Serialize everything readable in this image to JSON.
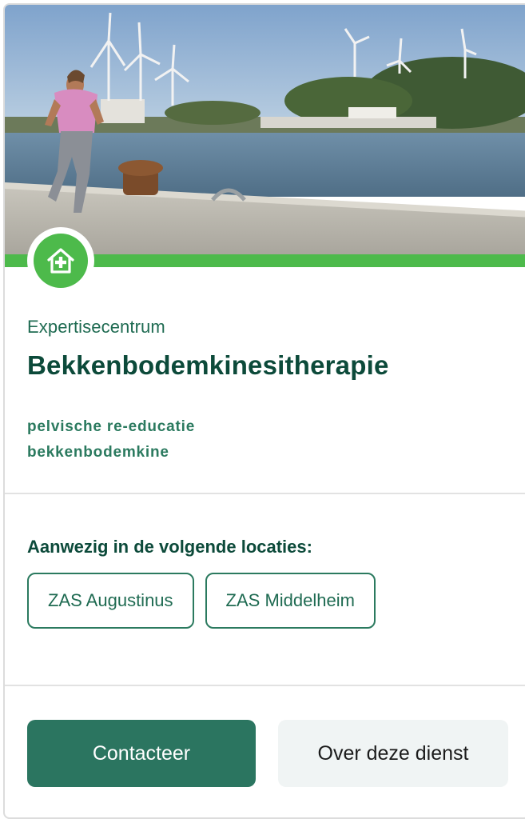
{
  "card": {
    "icon": "hospital-house-icon",
    "kicker": "Expertisecentrum",
    "title": "Bekkenbodemkinesitherapie",
    "tags": [
      "pelvische re-educatie",
      "bekkenbodemkine"
    ],
    "locations_heading": "Aanwezig in de volgende locaties:",
    "locations": [
      "ZAS Augustinus",
      "ZAS Middelheim"
    ],
    "primary_button": "Contacteer",
    "secondary_button": "Over deze dienst"
  },
  "colors": {
    "accent_green": "#4dba4b",
    "dark_green": "#0c4a3a",
    "button_green": "#2b7560",
    "secondary_bg": "#f0f4f4"
  }
}
